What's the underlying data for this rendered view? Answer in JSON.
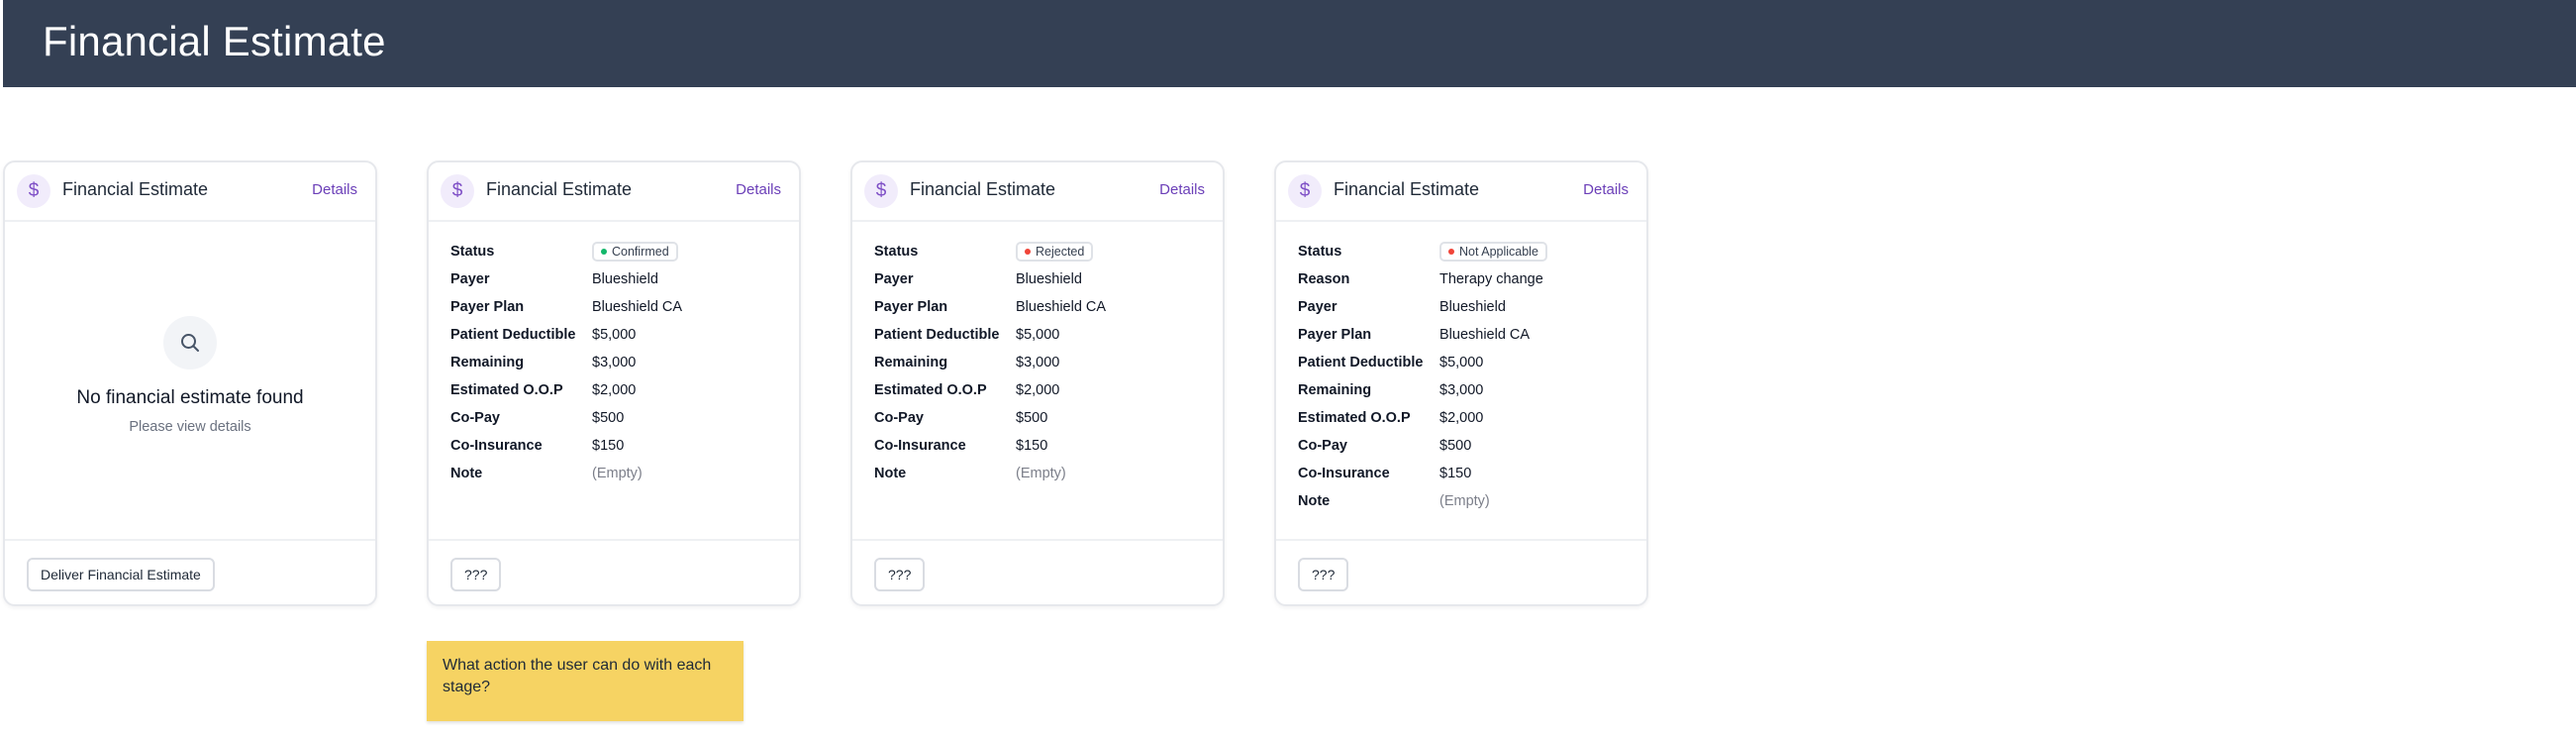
{
  "header": {
    "title": "Financial Estimate"
  },
  "colors": {
    "header_bg": "#344054",
    "accent": "#6b3fb8",
    "status_confirmed": "#12b76a",
    "status_rejected": "#f04438",
    "status_not_applicable": "#f04438",
    "sticky_note": "#f6d363"
  },
  "cards": [
    {
      "icon": "dollar-icon",
      "icon_glyph": "$",
      "title": "Financial Estimate",
      "details_label": "Details",
      "empty_state": {
        "icon": "search-icon",
        "title": "No financial estimate found",
        "subtitle": "Please view details"
      },
      "action_label": "Deliver Financial Estimate"
    },
    {
      "icon": "dollar-icon",
      "icon_glyph": "$",
      "title": "Financial Estimate",
      "details_label": "Details",
      "status_key": "Status",
      "status_value": "Confirmed",
      "fields": [
        {
          "key": "Payer",
          "value": "Blueshield"
        },
        {
          "key": "Payer Plan",
          "value": "Blueshield CA"
        },
        {
          "key": "Patient Deductible",
          "value": "$5,000"
        },
        {
          "key": "Remaining",
          "value": "$3,000"
        },
        {
          "key": "Estimated O.O.P",
          "value": "$2,000"
        },
        {
          "key": "Co-Pay",
          "value": "$500"
        },
        {
          "key": "Co-Insurance",
          "value": "$150"
        },
        {
          "key": "Note",
          "value": "(Empty)"
        }
      ],
      "action_label": "???"
    },
    {
      "icon": "dollar-icon",
      "icon_glyph": "$",
      "title": "Financial Estimate",
      "details_label": "Details",
      "status_key": "Status",
      "status_value": "Rejected",
      "fields": [
        {
          "key": "Payer",
          "value": "Blueshield"
        },
        {
          "key": "Payer Plan",
          "value": "Blueshield CA"
        },
        {
          "key": "Patient Deductible",
          "value": "$5,000"
        },
        {
          "key": "Remaining",
          "value": "$3,000"
        },
        {
          "key": "Estimated O.O.P",
          "value": "$2,000"
        },
        {
          "key": "Co-Pay",
          "value": "$500"
        },
        {
          "key": "Co-Insurance",
          "value": "$150"
        },
        {
          "key": "Note",
          "value": "(Empty)"
        }
      ],
      "action_label": "???"
    },
    {
      "icon": "dollar-icon",
      "icon_glyph": "$",
      "title": "Financial Estimate",
      "details_label": "Details",
      "status_key": "Status",
      "status_value": "Not Applicable",
      "fields": [
        {
          "key": "Reason",
          "value": "Therapy change"
        },
        {
          "key": "Payer",
          "value": "Blueshield"
        },
        {
          "key": "Payer Plan",
          "value": "Blueshield CA"
        },
        {
          "key": "Patient Deductible",
          "value": "$5,000"
        },
        {
          "key": "Remaining",
          "value": "$3,000"
        },
        {
          "key": "Estimated O.O.P",
          "value": "$2,000"
        },
        {
          "key": "Co-Pay",
          "value": "$500"
        },
        {
          "key": "Co-Insurance",
          "value": "$150"
        },
        {
          "key": "Note",
          "value": "(Empty)"
        }
      ],
      "action_label": "???"
    }
  ],
  "sticky_note": {
    "text": "What action the user can do with each stage?"
  }
}
